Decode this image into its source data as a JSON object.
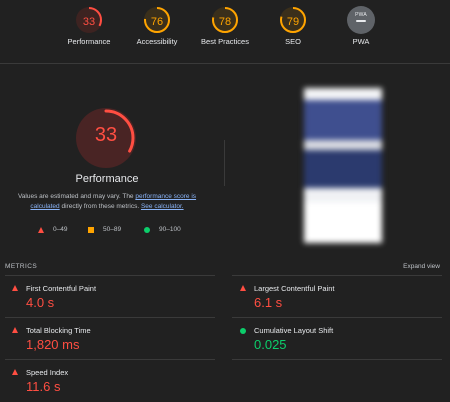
{
  "gauges": [
    {
      "label": "Performance",
      "score": "33",
      "value": 33,
      "color": "#ff4e42",
      "bg": "#3d2321"
    },
    {
      "label": "Accessibility",
      "score": "76",
      "value": 76,
      "color": "#ffa400",
      "bg": "#3a2f1b"
    },
    {
      "label": "Best Practices",
      "score": "78",
      "value": 78,
      "color": "#ffa400",
      "bg": "#3a2f1b"
    },
    {
      "label": "SEO",
      "score": "79",
      "value": 79,
      "color": "#ffa400",
      "bg": "#3a2f1b"
    },
    {
      "label": "PWA",
      "score": "PWA",
      "value": null,
      "color": "#5f6368",
      "bg": "#5f6368"
    }
  ],
  "performance": {
    "score": "33",
    "value": 33,
    "title": "Performance",
    "desc_prefix": "Values are estimated and may vary. The ",
    "desc_link1": "performance score is calculated",
    "desc_mid": " directly from these metrics. ",
    "desc_link2": "See calculator."
  },
  "legend": {
    "fail": "0–49",
    "average": "50–89",
    "pass": "90–100"
  },
  "metrics": {
    "heading": "METRICS",
    "expand_label": "Expand view",
    "items": [
      {
        "name": "First Contentful Paint",
        "value": "4.0 s",
        "status": "fail"
      },
      {
        "name": "Largest Contentful Paint",
        "value": "6.1 s",
        "status": "fail"
      },
      {
        "name": "Total Blocking Time",
        "value": "1,820 ms",
        "status": "fail"
      },
      {
        "name": "Cumulative Layout Shift",
        "value": "0.025",
        "status": "pass"
      },
      {
        "name": "Speed Index",
        "value": "11.6 s",
        "status": "fail"
      }
    ]
  },
  "colors": {
    "fail": "#ff4e42",
    "average": "#ffa400",
    "pass": "#0cce6b",
    "background": "#212121"
  }
}
